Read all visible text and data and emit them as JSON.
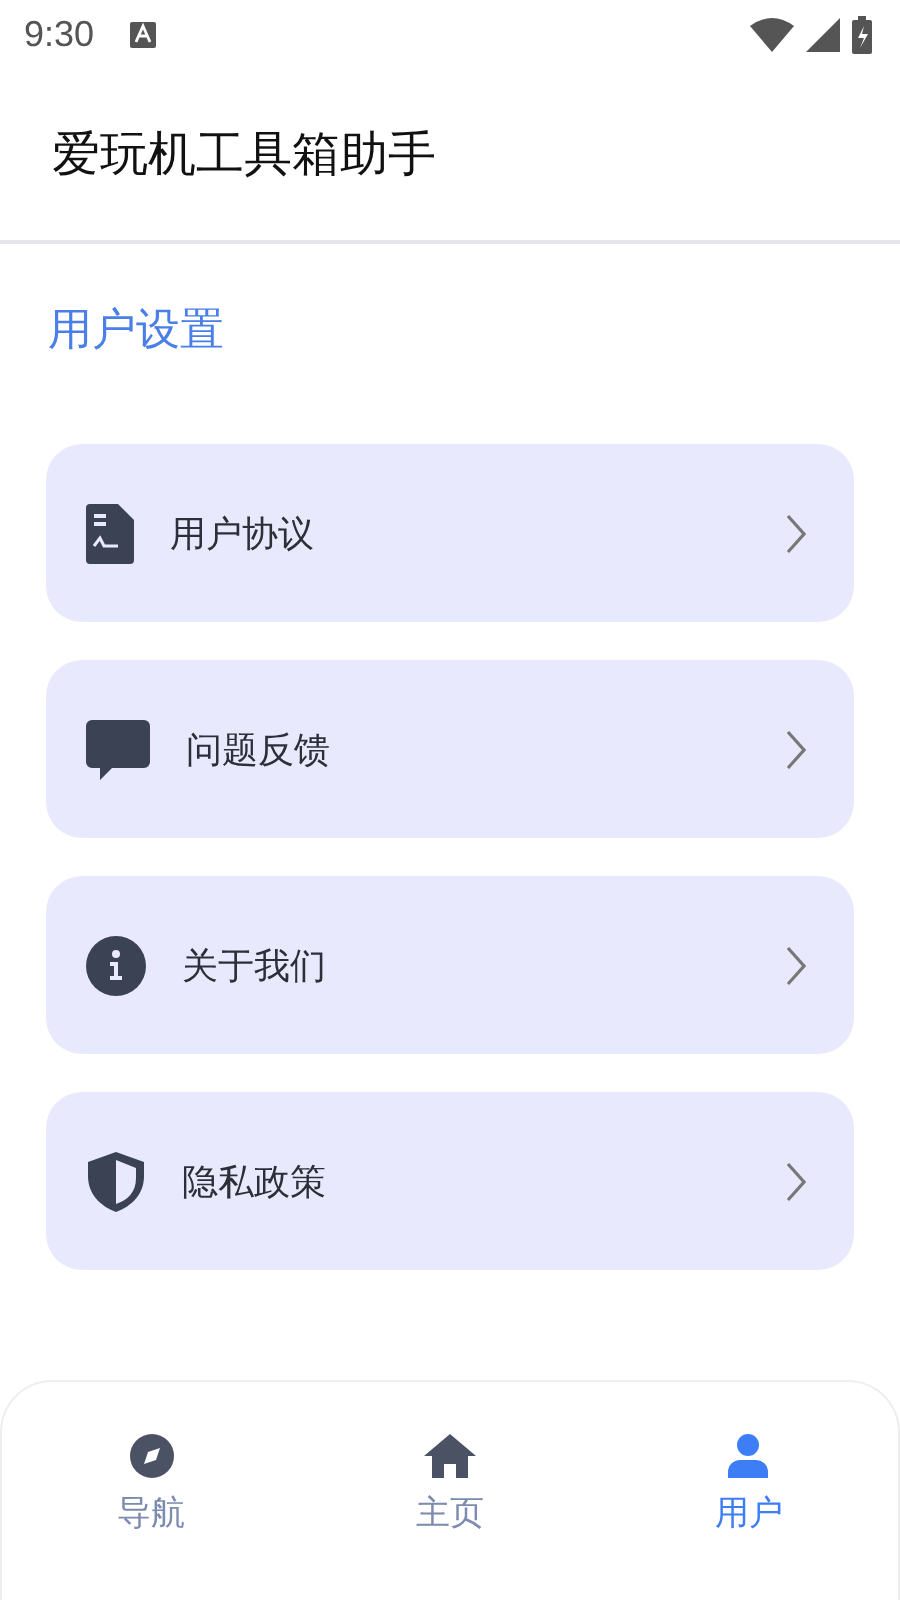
{
  "status_bar": {
    "time": "9:30"
  },
  "app_bar": {
    "title": "爱玩机工具箱助手"
  },
  "section": {
    "title": "用户设置"
  },
  "menu_items": [
    {
      "kind": "document",
      "label": "用户协议"
    },
    {
      "kind": "chat",
      "label": "问题反馈"
    },
    {
      "kind": "info",
      "label": "关于我们"
    },
    {
      "kind": "shield",
      "label": "隐私政策"
    }
  ],
  "bottom_nav": [
    {
      "kind": "compass",
      "label": "导航",
      "selected": false
    },
    {
      "kind": "home",
      "label": "主页",
      "selected": false
    },
    {
      "kind": "user",
      "label": "用户",
      "selected": true
    }
  ]
}
